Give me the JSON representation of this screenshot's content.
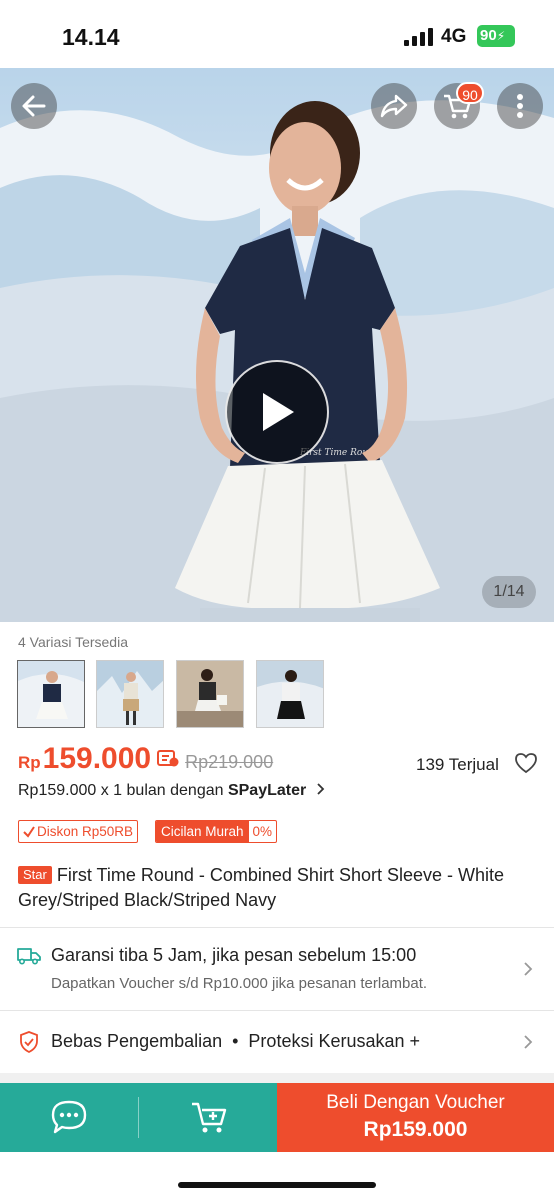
{
  "status_bar": {
    "time": "14.14",
    "network": "4G",
    "battery": "90"
  },
  "hero": {
    "cart_count": "90",
    "image_counter": "1/14",
    "shirt_text": "First Time Round"
  },
  "variations": {
    "label": "4 Variasi Tersedia"
  },
  "price": {
    "currency": "Rp",
    "current": "159.000",
    "original": "Rp219.000",
    "sold": "139 Terjual",
    "installment_prefix": "Rp159.000 x 1 bulan dengan ",
    "installment_brand": "SPayLater"
  },
  "badges": {
    "discount": "Diskon Rp50RB",
    "cicilan": "Cicilan Murah",
    "cicilan_pct": "0%"
  },
  "product": {
    "star_badge": "Star",
    "title": "First Time Round - Combined Shirt Short Sleeve - White Grey/Striped Black/Striped Navy"
  },
  "shipping": {
    "title": "Garansi tiba 5 Jam, jika pesan sebelum 15:00",
    "subtitle": "Dapatkan Voucher s/d Rp10.000 jika pesanan terlambat."
  },
  "returns": {
    "text": "Bebas Pengembalian  •  Proteksi Kerusakan +"
  },
  "bottom_bar": {
    "buy_label": "Beli Dengan Voucher",
    "buy_price": "Rp159.000"
  },
  "colors": {
    "accent": "#ee4d2d",
    "green": "#26aa99"
  }
}
